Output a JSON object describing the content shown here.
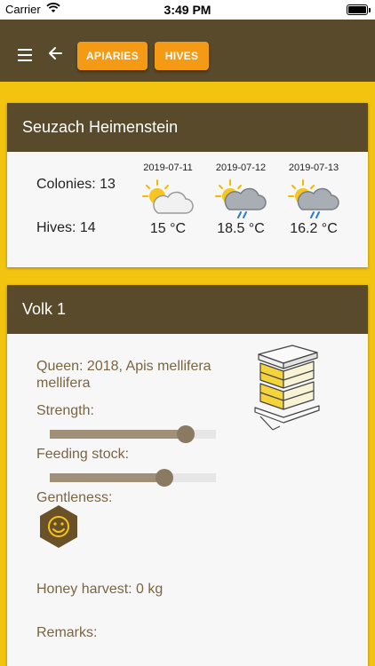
{
  "status_bar": {
    "carrier": "Carrier",
    "time": "3:49 PM"
  },
  "nav": {
    "menu_icon": "hamburger-menu-icon",
    "back_icon": "arrow-left-icon",
    "apiaries_label": "APIARIES",
    "hives_label": "HIVES"
  },
  "apiary": {
    "name": "Seuzach Heimenstein",
    "colonies_label": "Colonies: 13",
    "hives_label": "Hives: 14",
    "weather": [
      {
        "date": "2019-07-11",
        "temp": "15 °C",
        "icon": "partly-cloudy-icon"
      },
      {
        "date": "2019-07-12",
        "temp": "18.5 °C",
        "icon": "cloud-rain-icon"
      },
      {
        "date": "2019-07-13",
        "temp": "16.2 °C",
        "icon": "cloud-rain-icon"
      }
    ]
  },
  "colony": {
    "name": "Volk 1",
    "queen": "Queen: 2018, Apis mellifera mellifera",
    "strength_label": "Strength:",
    "strength_value": 0.82,
    "feeding_label": "Feeding stock:",
    "feeding_value": 0.69,
    "gentleness_label": "Gentleness:",
    "gentleness_icon": "smiley-hexagon-icon",
    "honey_label": "Honey harvest: 0 kg",
    "remarks_label": "Remarks:",
    "hive_illustration": "beehive-boxes-illustration"
  },
  "colors": {
    "brown": "#5a4a2c",
    "accent_orange": "#f59a14",
    "yellow_background": "#f2c40f",
    "label_brown": "#7a6543"
  }
}
